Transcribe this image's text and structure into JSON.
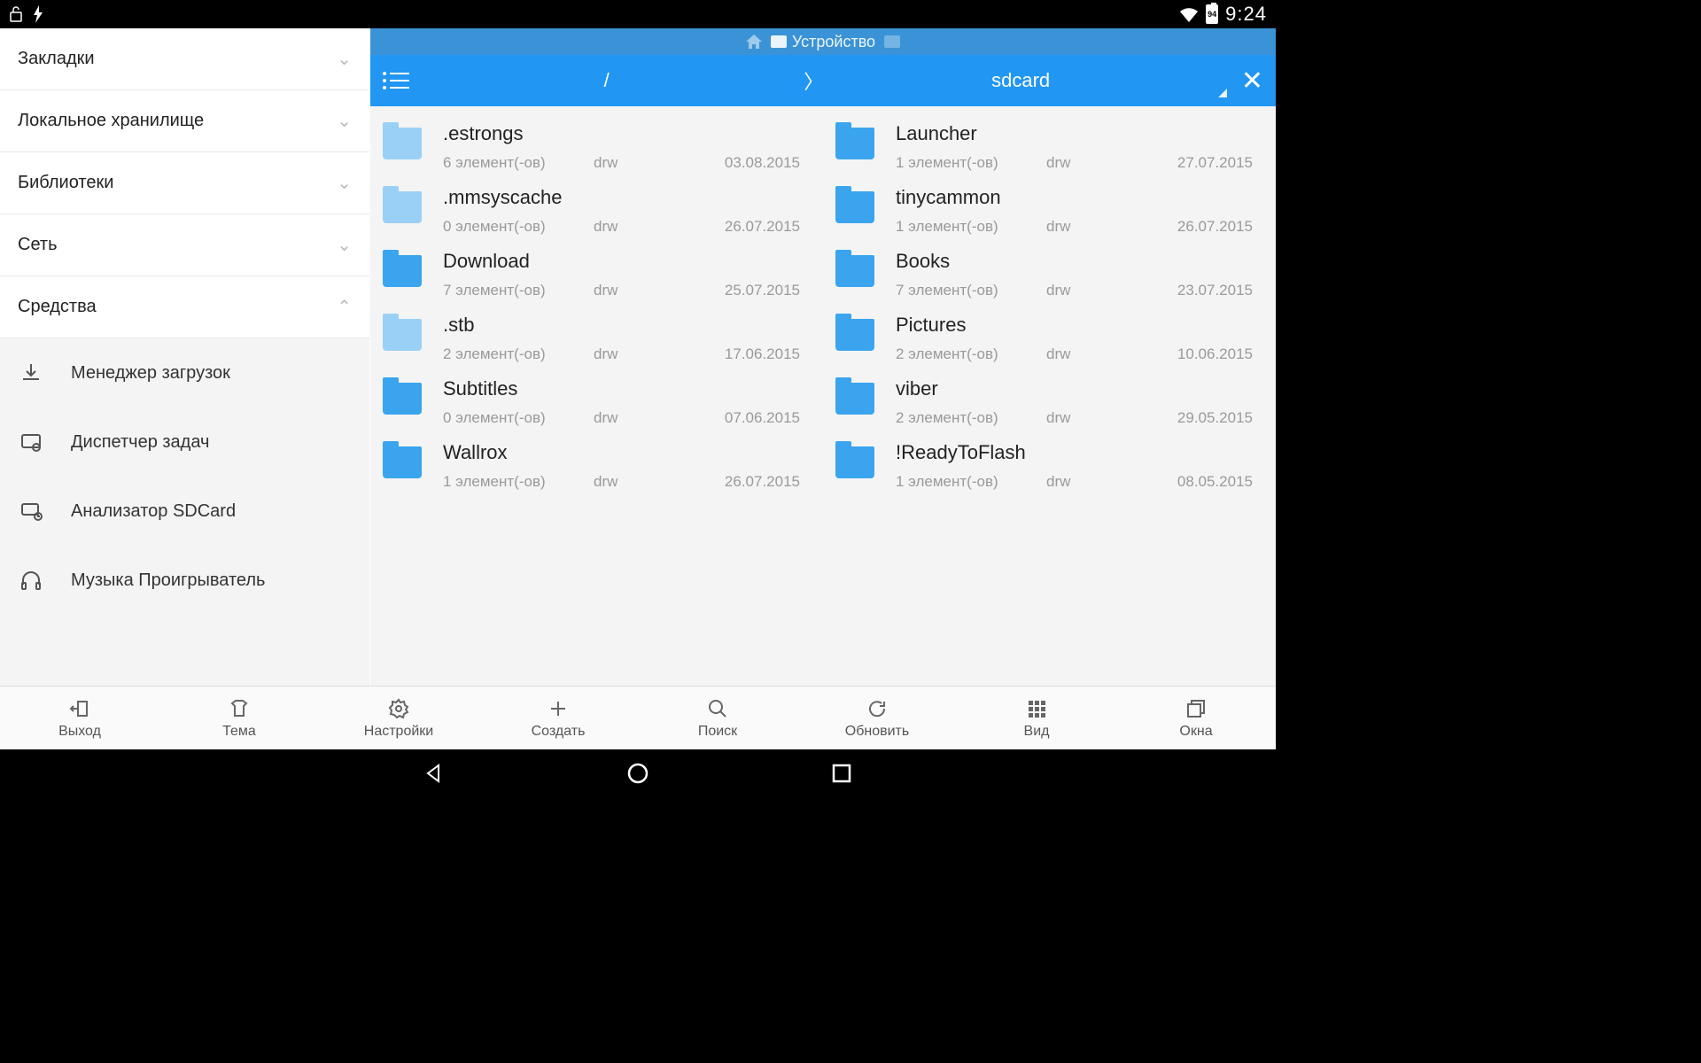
{
  "status": {
    "battery": "94",
    "time": "9:24"
  },
  "sidebar": {
    "sections": [
      {
        "label": "Закладки"
      },
      {
        "label": "Локальное хранилище"
      },
      {
        "label": "Библиотеки"
      },
      {
        "label": "Сеть"
      },
      {
        "label": "Средства"
      }
    ],
    "tools": [
      {
        "label": "Менеджер загрузок"
      },
      {
        "label": "Диспетчер задач"
      },
      {
        "label": "Анализатор SDCard"
      },
      {
        "label": "Музыка Проигрыватель"
      }
    ]
  },
  "tabs": {
    "device_label": "Устройство"
  },
  "path": {
    "root": "/",
    "sep": "〉",
    "current": "sdcard"
  },
  "files_left": [
    {
      "name": ".estrongs",
      "count": "6 элемент(-ов)",
      "perm": "drw",
      "date": "03.08.2015",
      "style": "light"
    },
    {
      "name": ".mmsyscache",
      "count": "0 элемент(-ов)",
      "perm": "drw",
      "date": "26.07.2015",
      "style": "light"
    },
    {
      "name": "Download",
      "count": "7 элемент(-ов)",
      "perm": "drw",
      "date": "25.07.2015",
      "style": ""
    },
    {
      "name": ".stb",
      "count": "2 элемент(-ов)",
      "perm": "drw",
      "date": "17.06.2015",
      "style": "light"
    },
    {
      "name": "Subtitles",
      "count": "0 элемент(-ов)",
      "perm": "drw",
      "date": "07.06.2015",
      "style": ""
    },
    {
      "name": "Wallrox",
      "count": "1 элемент(-ов)",
      "perm": "drw",
      "date": "26.07.2015",
      "style": ""
    }
  ],
  "files_right": [
    {
      "name": "Launcher",
      "count": "1 элемент(-ов)",
      "perm": "drw",
      "date": "27.07.2015",
      "style": ""
    },
    {
      "name": "tinycammon",
      "count": "1 элемент(-ов)",
      "perm": "drw",
      "date": "26.07.2015",
      "style": ""
    },
    {
      "name": "Books",
      "count": "7 элемент(-ов)",
      "perm": "drw",
      "date": "23.07.2015",
      "style": ""
    },
    {
      "name": "Pictures",
      "count": "2 элемент(-ов)",
      "perm": "drw",
      "date": "10.06.2015",
      "style": ""
    },
    {
      "name": "viber",
      "count": "2 элемент(-ов)",
      "perm": "drw",
      "date": "29.05.2015",
      "style": ""
    },
    {
      "name": "!ReadyToFlash",
      "count": "1 элемент(-ов)",
      "perm": "drw",
      "date": "08.05.2015",
      "style": ""
    }
  ],
  "toolbar": [
    {
      "label": "Выход"
    },
    {
      "label": "Тема"
    },
    {
      "label": "Настройки"
    },
    {
      "label": "Создать"
    },
    {
      "label": "Поиск"
    },
    {
      "label": "Обновить"
    },
    {
      "label": "Вид"
    },
    {
      "label": "Окна"
    }
  ]
}
